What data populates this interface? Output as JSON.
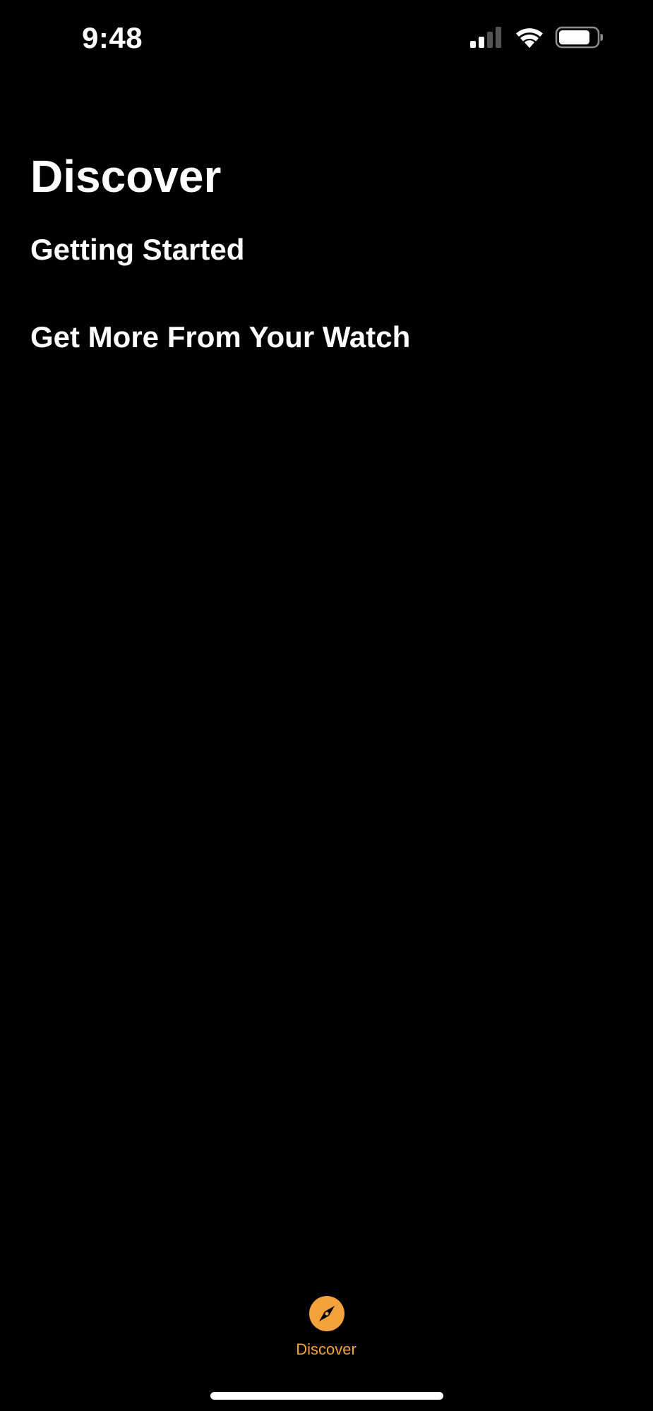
{
  "status_bar": {
    "time": "9:48",
    "signal_icon": "cellular-signal-icon",
    "wifi_icon": "wifi-icon",
    "battery_icon": "battery-icon"
  },
  "page": {
    "title": "Discover"
  },
  "sections": [
    {
      "label": "Getting Started"
    },
    {
      "label": "Get More From Your Watch"
    }
  ],
  "tab_bar": {
    "items": [
      {
        "label": "Discover",
        "icon": "compass-icon",
        "selected": true
      }
    ]
  },
  "colors": {
    "background": "#000000",
    "accent": "#f4a23b",
    "text": "#ffffff"
  }
}
